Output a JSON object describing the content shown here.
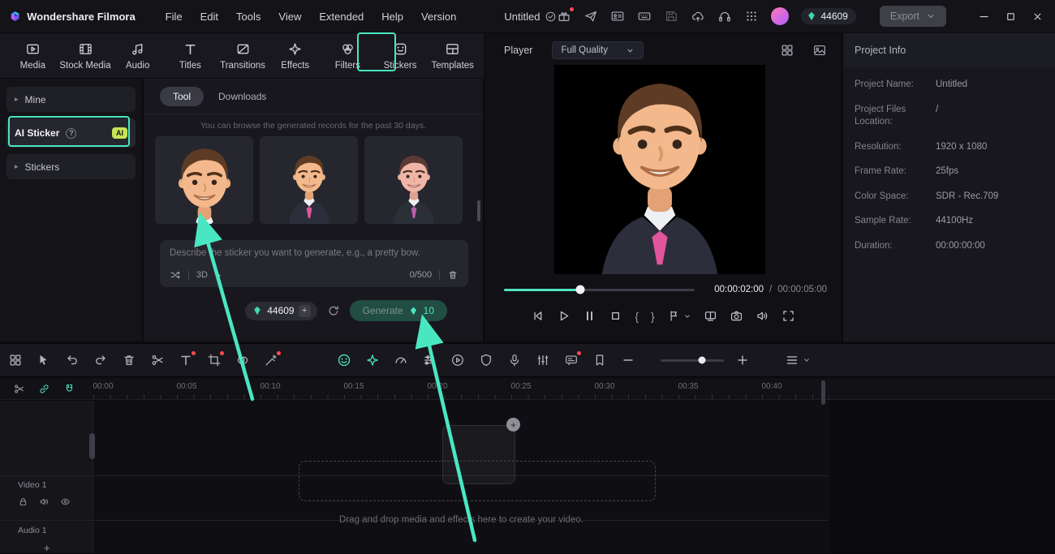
{
  "titlebar": {
    "app_name": "Wondershare Filmora",
    "menus": [
      "File",
      "Edit",
      "Tools",
      "View",
      "Extended",
      "Help",
      "Version"
    ],
    "project_title": "Untitled",
    "coin_count": "44609",
    "export_label": "Export"
  },
  "ribbon": {
    "tabs": [
      {
        "label": "Media"
      },
      {
        "label": "Stock Media"
      },
      {
        "label": "Audio"
      },
      {
        "label": "Titles"
      },
      {
        "label": "Transitions"
      },
      {
        "label": "Effects"
      },
      {
        "label": "Filters"
      },
      {
        "label": "Stickers"
      },
      {
        "label": "Templates"
      }
    ]
  },
  "sidebar": {
    "items": [
      {
        "label": "Mine"
      },
      {
        "label": "AI Sticker",
        "badge": "AI"
      },
      {
        "label": "Stickers"
      }
    ]
  },
  "sticker_panel": {
    "tab_tool": "Tool",
    "tab_downloads": "Downloads",
    "note": "You can browse the generated records for the past 30 days.",
    "prompt_placeholder": "Describe the sticker you want to generate, e.g., a pretty bow.",
    "style_selected": "3D",
    "char_counter": "0/500",
    "coin_balance": "44609",
    "coin_add": "+",
    "generate_label": "Generate",
    "generate_cost": "10"
  },
  "player": {
    "label": "Player",
    "quality": "Full Quality",
    "current_time": "00:00:02:00",
    "time_separator": "/",
    "total_time": "00:00:05:00",
    "mark_in": "{",
    "mark_out": "}"
  },
  "project_info": {
    "title": "Project Info",
    "rows": [
      {
        "label": "Project Name:",
        "value": "Untitled"
      },
      {
        "label": "Project Files Location:",
        "value": "/"
      },
      {
        "label": "Resolution:",
        "value": "1920 x 1080"
      },
      {
        "label": "Frame Rate:",
        "value": "25fps"
      },
      {
        "label": "Color Space:",
        "value": "SDR - Rec.709"
      },
      {
        "label": "Sample Rate:",
        "value": "44100Hz"
      },
      {
        "label": "Duration:",
        "value": "00:00:00:00"
      }
    ]
  },
  "timeline": {
    "ruler_labels": [
      "00:00",
      "00:05",
      "00:10",
      "00:15",
      "00:20",
      "00:25",
      "00:30",
      "00:35",
      "00:40"
    ],
    "video_track": "Video 1",
    "audio_track": "Audio 1",
    "add_track": "+",
    "dropzone_text": "Drag and drop media and effects here to create your video.",
    "ghost_plus": "+"
  },
  "colors": {
    "accent": "#4fe3c1",
    "ai_badge": "#c9e355",
    "red_dot": "#ff4b4e"
  }
}
